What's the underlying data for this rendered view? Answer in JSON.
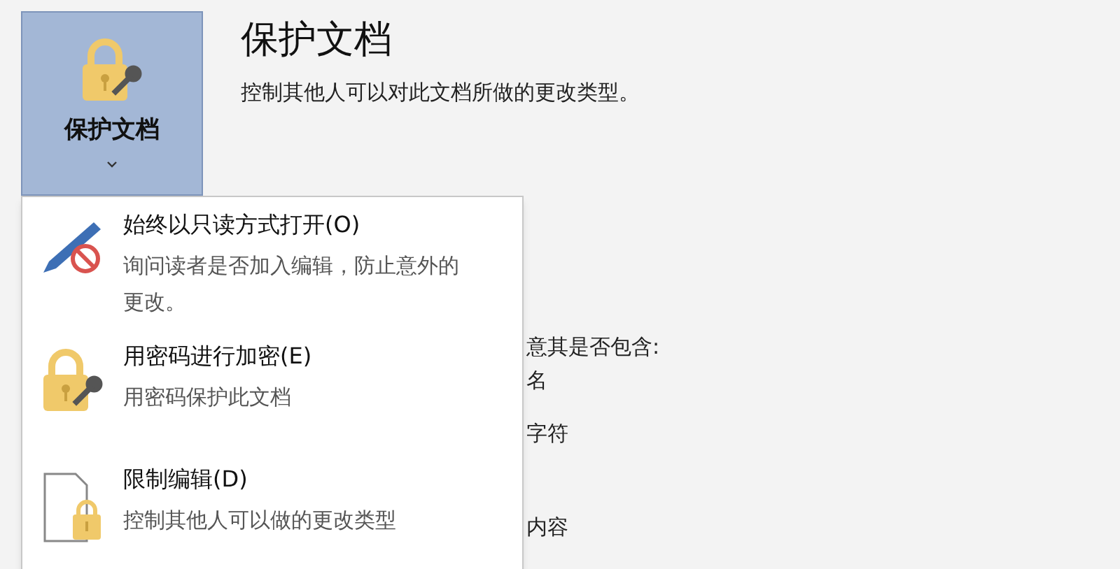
{
  "protect_button": {
    "label": "保护文档",
    "expanded": true
  },
  "heading": {
    "title": "保护文档",
    "description": "控制其他人可以对此文档所做的更改类型。"
  },
  "background_lines": [
    "意其是否包含:",
    "名",
    "字符",
    "内容"
  ],
  "menu_items": [
    {
      "kind": "readonly",
      "title": "始终以只读方式打开(O)",
      "description": "询问读者是否加入编辑，防止意外的更改。"
    },
    {
      "kind": "encrypt",
      "title": "用密码进行加密(E)",
      "description": "用密码保护此文档"
    },
    {
      "kind": "restrict",
      "title": "限制编辑(D)",
      "description": "控制其他人可以做的更改类型"
    }
  ]
}
